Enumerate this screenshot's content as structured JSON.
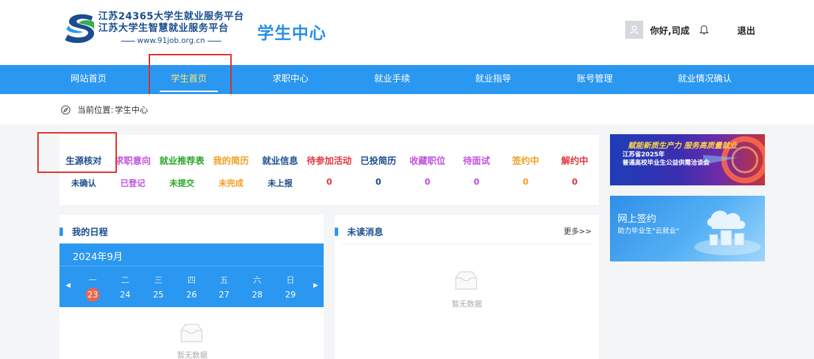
{
  "header": {
    "logo_line1": "江苏24365大学生就业服务平台",
    "logo_line2": "江苏大学生智慧就业服务平台",
    "logo_url": "www.91job.org.cn",
    "site_title": "学生中心",
    "greeting": "你好,司成",
    "logout": "退出",
    "icons": {
      "avatar": "user-icon",
      "bell": "bell-icon"
    }
  },
  "nav": {
    "items": [
      {
        "label": "网站首页"
      },
      {
        "label": "学生首页",
        "active": true
      },
      {
        "label": "求职中心"
      },
      {
        "label": "就业手续"
      },
      {
        "label": "就业指导"
      },
      {
        "label": "账号管理"
      },
      {
        "label": "就业情况确认"
      }
    ]
  },
  "breadcrumb": {
    "prefix": "当前位置:",
    "current": "学生中心",
    "icon": "compass-icon"
  },
  "status": {
    "items": [
      {
        "label": "生源核对",
        "value": "未确认",
        "color": "#1a4d8f"
      },
      {
        "label": "求职意向",
        "value": "已登记",
        "color": "#c04fe0"
      },
      {
        "label": "就业推荐表",
        "value": "未提交",
        "color": "#2ba62b"
      },
      {
        "label": "我的简历",
        "value": "未完成",
        "color": "#f0a020"
      },
      {
        "label": "就业信息",
        "value": "未上报",
        "color": "#1a4d8f"
      },
      {
        "label": "待参加活动",
        "value": "0",
        "color": "#e0383e"
      },
      {
        "label": "已投简历",
        "value": "0",
        "color": "#1a4d8f"
      },
      {
        "label": "收藏职位",
        "value": "0",
        "color": "#c04fe0"
      },
      {
        "label": "待面试",
        "value": "0",
        "color": "#c04fe0"
      },
      {
        "label": "签约中",
        "value": "0",
        "color": "#f0a020"
      },
      {
        "label": "解约中",
        "value": "0",
        "color": "#e0383e"
      }
    ]
  },
  "schedule": {
    "title": "我的日程",
    "month": "2024年9月",
    "weekdays": [
      "一",
      "二",
      "三",
      "四",
      "五",
      "六",
      "日"
    ],
    "days": [
      "23",
      "24",
      "25",
      "26",
      "27",
      "28",
      "29"
    ],
    "today": "23",
    "prev": "◀",
    "next": "▶",
    "empty_text": "暂无数据"
  },
  "messages": {
    "title": "未读消息",
    "more": "更多>>",
    "empty_text": "暂无数据"
  },
  "banners": {
    "b1_line1": "赋能新质生产力 服务高质量就业",
    "b1_line2": "江苏省2025年",
    "b1_line3": "普通高校毕业生公益供需洽谈会",
    "b2_line1": "网上签约",
    "b2_line2": "助力毕业生\"云就业\""
  },
  "colors": {
    "brand_blue": "#2a97f0",
    "title_blue": "#2a8ee8",
    "dark_blue": "#1a4d8f",
    "nav_active": "#ffe96b",
    "highlight_red": "#e02b20",
    "today_red": "#f0634d"
  }
}
